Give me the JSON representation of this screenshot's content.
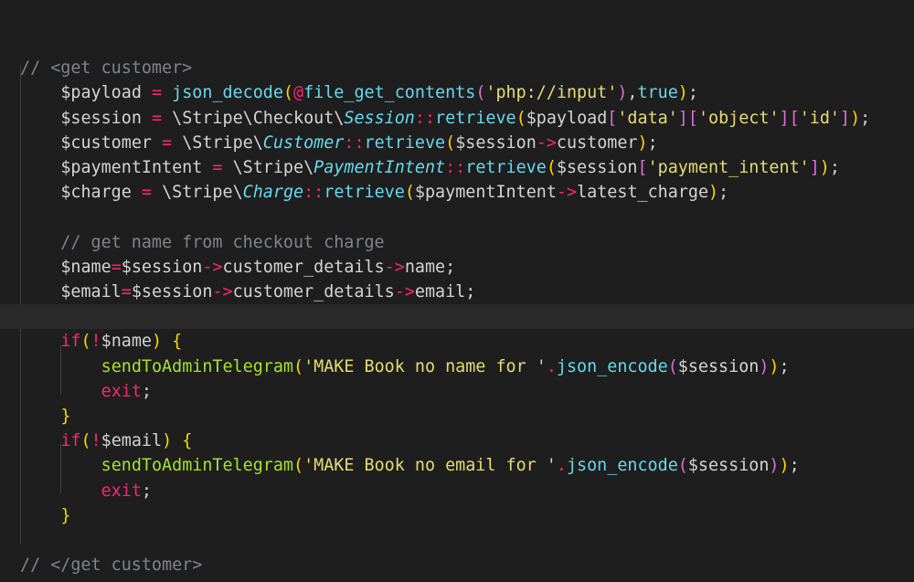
{
  "editor": {
    "lines": [
      "",
      "// <get customer>",
      "    $payload = json_decode(@file_get_contents('php://input'),true);",
      "    $session = \\Stripe\\Checkout\\Session::retrieve($payload['data']['object']['id']);",
      "    $customer = \\Stripe\\Customer::retrieve($session->customer);",
      "    $paymentIntent = \\Stripe\\PaymentIntent::retrieve($session['payment_intent']);",
      "    $charge = \\Stripe\\Charge::retrieve($paymentIntent->latest_charge);",
      "",
      "    // get name from checkout charge",
      "    $name=$session->customer_details->name;",
      "    $email=$session->customer_details->email;",
      "",
      "    if(!$name) {",
      "        sendToAdminTelegram('MAKE Book no name for '.json_encode($session));",
      "        exit;",
      "    }",
      "    if(!$email) {",
      "        sendToAdminTelegram('MAKE Book no email for '.json_encode($session));",
      "        exit;",
      "    }",
      "",
      "// </get customer>"
    ],
    "current_line": 11
  }
}
